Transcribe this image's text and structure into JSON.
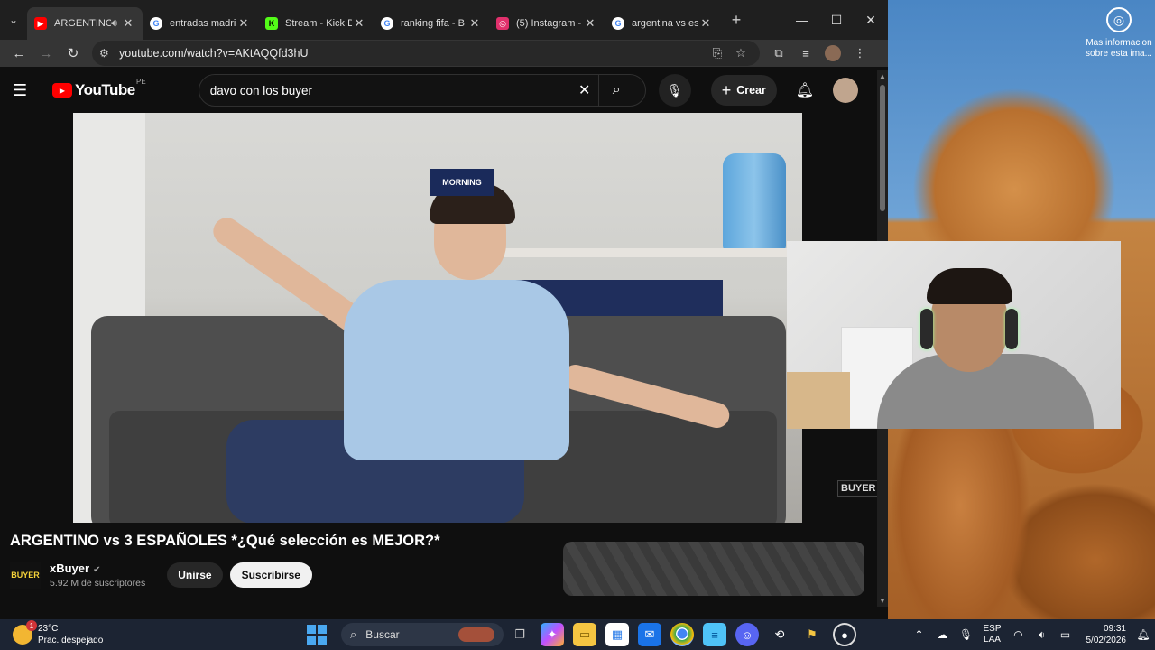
{
  "browser": {
    "tabs": [
      {
        "title": "ARGENTINO",
        "favicon": "youtube-icon",
        "favicon_color": "#ff0000",
        "active": true,
        "audio": true
      },
      {
        "title": "entradas madri",
        "favicon": "google-icon",
        "favicon_color": "#4285f4"
      },
      {
        "title": "Stream - Kick D",
        "favicon": "kick-icon",
        "favicon_color": "#53fc18"
      },
      {
        "title": "ranking fifa - B",
        "favicon": "google-icon",
        "favicon_color": "#4285f4"
      },
      {
        "title": "(5) Instagram -",
        "favicon": "instagram-icon",
        "favicon_color": "#e1306c"
      },
      {
        "title": "argentina vs esp",
        "favicon": "google-icon",
        "favicon_color": "#4285f4"
      }
    ],
    "url": "youtube.com/watch?v=AKtAQQfd3hU"
  },
  "youtube": {
    "logo_text": "YouTube",
    "country_code": "PE",
    "search_query": "davo con los buyer",
    "create_label": "Crear",
    "video_title": "ARGENTINO vs 3 ESPAÑOLES *¿Qué selección es MEJOR?*",
    "channel_name": "xBuyer",
    "channel_logo_text": "BUYER",
    "subscribers": "5.92 M de suscriptores",
    "join_label": "Unirse",
    "subscribe_label": "Suscribirse",
    "watermark": "BUYER",
    "jersey_text": "MORNING"
  },
  "desktop": {
    "icon_label": "Mas informacion sobre esta ima..."
  },
  "taskbar": {
    "temperature": "23°C",
    "weather_desc": "Prac. despejado",
    "weather_badge": "1",
    "search_label": "Buscar",
    "lang_top": "ESP",
    "lang_bottom": "LAA",
    "time": "09:31",
    "date": "5/02/2026"
  }
}
